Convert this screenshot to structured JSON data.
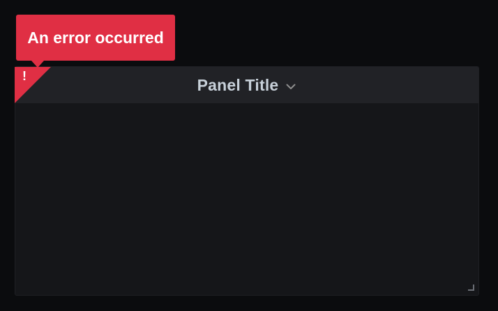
{
  "panel": {
    "title": "Panel Title"
  },
  "error": {
    "glyph": "!",
    "message": "An error occurred"
  },
  "icons": {
    "title_menu": "chevron-down-icon",
    "error_indicator": "exclamation-icon",
    "resize": "resize-handle-icon"
  },
  "colors": {
    "background": "#0b0c0e",
    "panel_header": "#212226",
    "panel_body": "#151619",
    "title_text": "#c7d0d9",
    "error_red": "#e02f44",
    "tooltip_text": "#ffffff"
  }
}
